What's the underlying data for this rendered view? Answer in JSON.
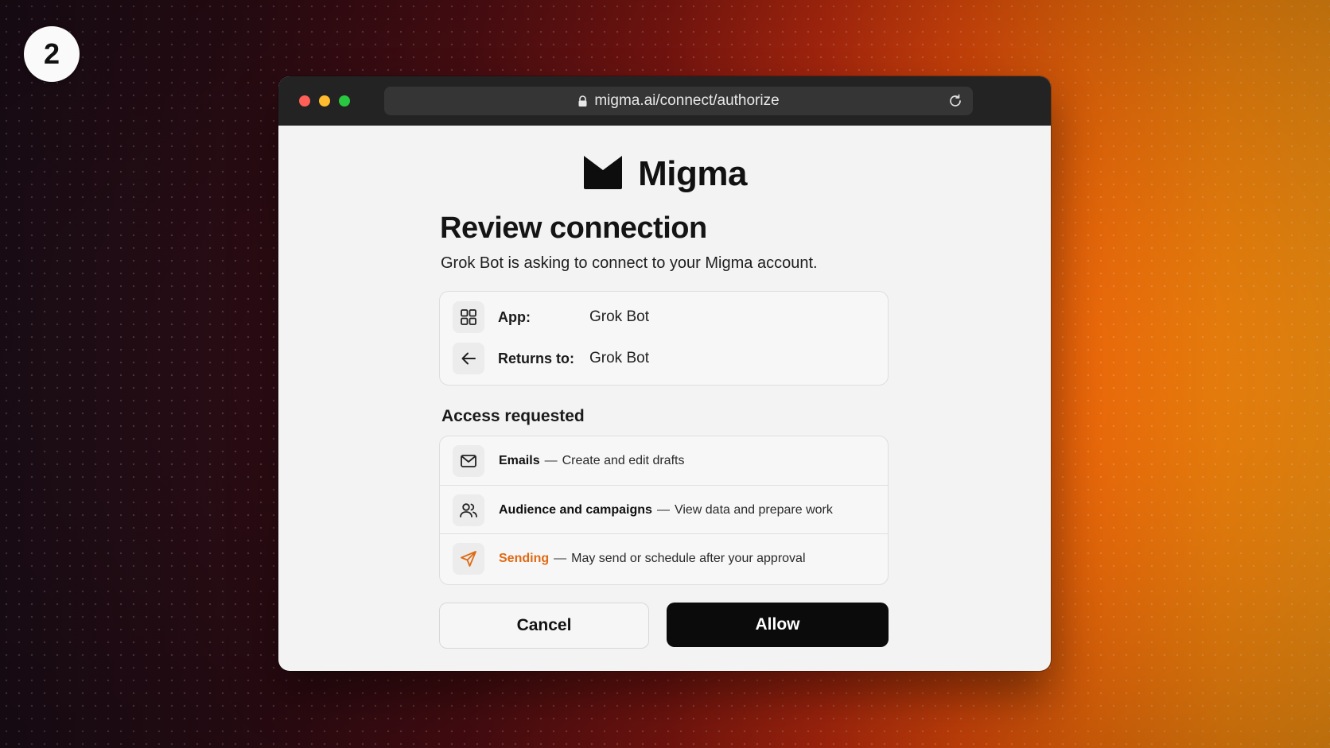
{
  "step_badge": "2",
  "browser": {
    "url": "migma.ai/connect/authorize"
  },
  "brand": {
    "name": "Migma"
  },
  "dialog": {
    "title": "Review connection",
    "subtitle": "Grok Bot is asking to connect to your Migma account.",
    "info": [
      {
        "icon": "grid-icon",
        "label": "App:",
        "value": "Grok Bot"
      },
      {
        "icon": "arrow-left-icon",
        "label": "Returns to:",
        "value": "Grok Bot"
      }
    ],
    "access_title": "Access requested",
    "access": [
      {
        "icon": "mail-icon",
        "name": "Emails",
        "separator": "—",
        "description": "Create and edit drafts"
      },
      {
        "icon": "users-icon",
        "name": "Audience and campaigns",
        "separator": "—",
        "description": "View data and prepare work"
      },
      {
        "icon": "send-icon",
        "name": "Sending",
        "separator": "—",
        "description": "May send or schedule after your approval",
        "accent": "#e06a14"
      }
    ],
    "cancel_label": "Cancel",
    "allow_label": "Allow"
  }
}
